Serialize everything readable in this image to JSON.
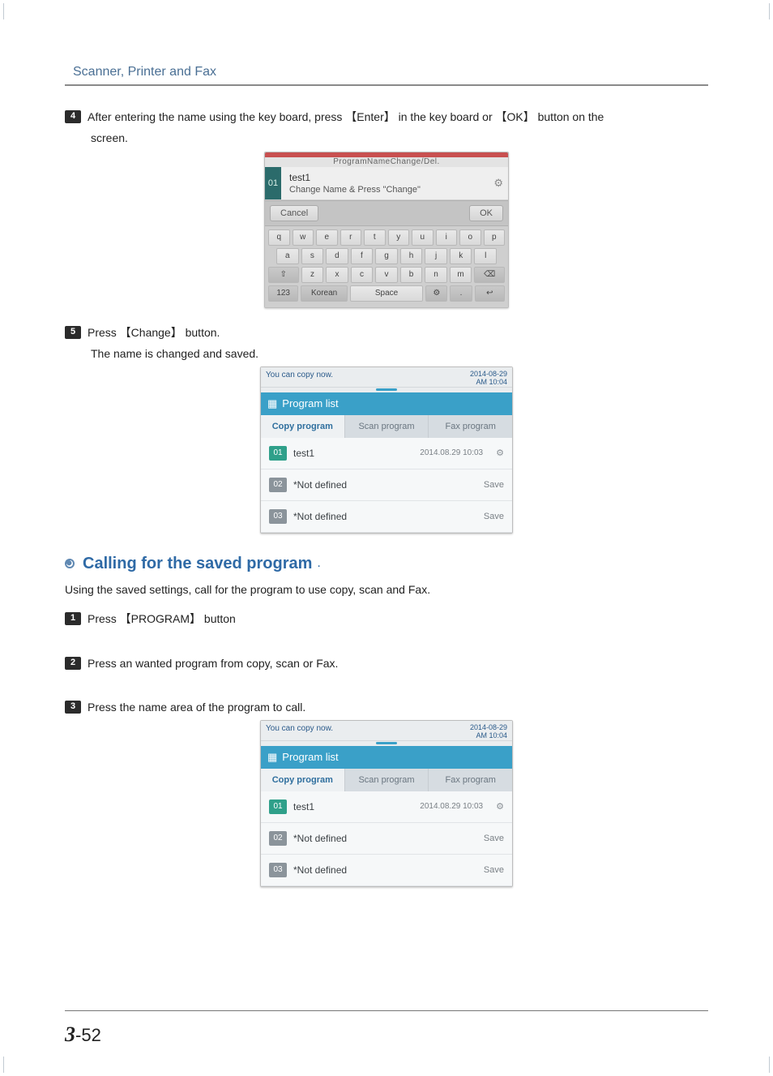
{
  "doc": {
    "section_title": "Scanner, Printer and Fax",
    "step4_text": "After entering the name using the key board, press 【Enter】 in the key board or 【OK】 button on the",
    "step4_cont": "screen.",
    "step5_text": "Press 【Change】 button.",
    "step5_cont": "The name is changed and saved.",
    "subtitle": "Calling for the saved program",
    "subtitle_period": ".",
    "intro": "Using the saved settings, call for the program to use copy, scan and Fax.",
    "stepA_text": "Press 【PROGRAM】 button",
    "stepB_text": "Press an wanted program from copy, scan or Fax.",
    "stepC_text": "Press the name area of the program to call.",
    "page_chapter": "3",
    "page_sep": "-",
    "page_no": "52"
  },
  "step_labels": {
    "4": "4",
    "5": "5",
    "1": "1",
    "2": "2",
    "3": "3"
  },
  "kb": {
    "title_partial": "ProgramNameChange/Del.",
    "slot_num": "01",
    "field_value": "test1",
    "hint": "Change Name & Press \"Change\"",
    "cancel": "Cancel",
    "ok": "OK",
    "rows": {
      "r1": [
        "q",
        "w",
        "e",
        "r",
        "t",
        "y",
        "u",
        "i",
        "o",
        "p"
      ],
      "r2": [
        "a",
        "s",
        "d",
        "f",
        "g",
        "h",
        "j",
        "k",
        "l"
      ],
      "r3": [
        "⇧",
        "z",
        "x",
        "c",
        "v",
        "b",
        "n",
        "m",
        "⌫"
      ],
      "r4": [
        "123",
        "Korean",
        "Space",
        "⚙",
        ".",
        "↩"
      ]
    }
  },
  "pl": {
    "status_left": "You can copy now.",
    "status_date": "2014-08-29",
    "status_time": "AM 10:04",
    "header": "Program list",
    "tabs": {
      "copy": "Copy program",
      "scan": "Scan program",
      "fax": "Fax program"
    },
    "rows": [
      {
        "num": "01",
        "name": "test1",
        "date": "2014.08.29 10:03",
        "action": "⚙",
        "defined": true
      },
      {
        "num": "02",
        "name": "*Not defined",
        "date": "",
        "action": "Save",
        "defined": false
      },
      {
        "num": "03",
        "name": "*Not defined",
        "date": "",
        "action": "Save",
        "defined": false
      }
    ]
  }
}
